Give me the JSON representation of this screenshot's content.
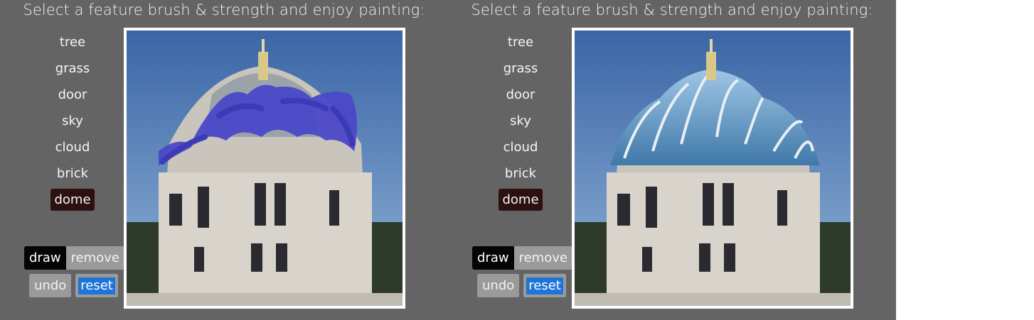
{
  "panels": [
    {
      "title": "Select a feature brush & strength and enjoy painting:",
      "features": [
        "tree",
        "grass",
        "door",
        "sky",
        "cloud",
        "brick",
        "dome"
      ],
      "active_feature": "dome",
      "mode_buttons": {
        "draw": "draw",
        "remove": "remove"
      },
      "action_buttons": {
        "undo": "undo",
        "reset": "reset"
      },
      "active_mode": "draw",
      "has_brush_strokes": true
    },
    {
      "title": "Select a feature brush & strength and enjoy painting:",
      "features": [
        "tree",
        "grass",
        "door",
        "sky",
        "cloud",
        "brick",
        "dome"
      ],
      "active_feature": "dome",
      "mode_buttons": {
        "draw": "draw",
        "remove": "remove"
      },
      "action_buttons": {
        "undo": "undo",
        "reset": "reset"
      },
      "active_mode": "draw",
      "has_brush_strokes": false
    }
  ],
  "colors": {
    "background": "#646464",
    "active_feature_bg": "#2d1111",
    "draw_button_bg": "#050505",
    "reset_highlight": "#1f74d8",
    "brush_stroke": "#4b48c8"
  }
}
